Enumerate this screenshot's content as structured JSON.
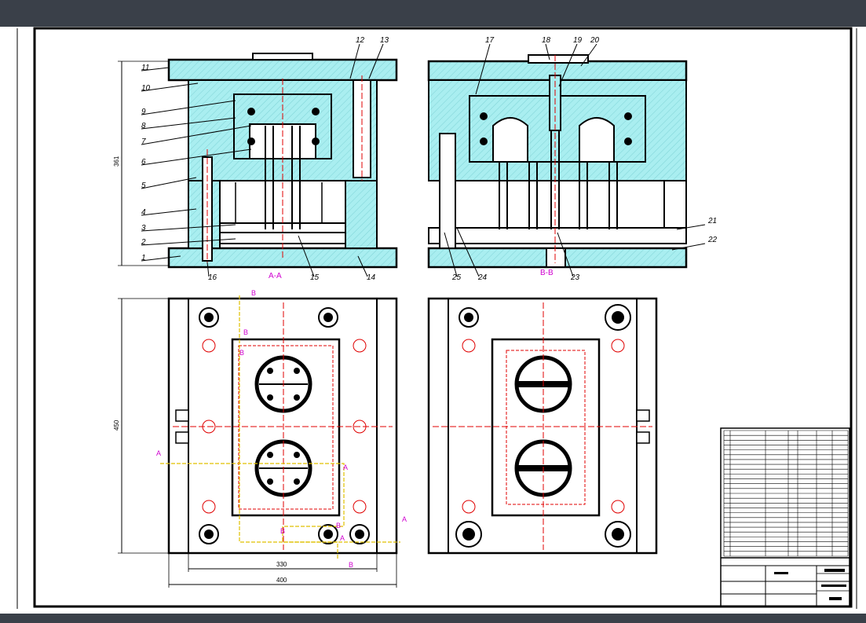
{
  "sections": {
    "aa": "A-A",
    "bb": "B-B"
  },
  "part_numbers": [
    "1",
    "2",
    "3",
    "4",
    "5",
    "6",
    "7",
    "8",
    "9",
    "10",
    "11",
    "12",
    "13",
    "14",
    "15",
    "16",
    "17",
    "18",
    "19",
    "20",
    "21",
    "22",
    "23",
    "24",
    "25"
  ],
  "dimensions": {
    "height_361": "361",
    "height_450": "450",
    "width_330": "330",
    "width_400": "400"
  },
  "section_markers": {
    "A": "A",
    "B": "B"
  },
  "colors": {
    "topbar": "#3a4049",
    "cyan_fill": "#a9eef0",
    "outline": "#000000",
    "center_line": "#e00000",
    "section_line": "#e0c000",
    "marker": "#d000d0"
  }
}
